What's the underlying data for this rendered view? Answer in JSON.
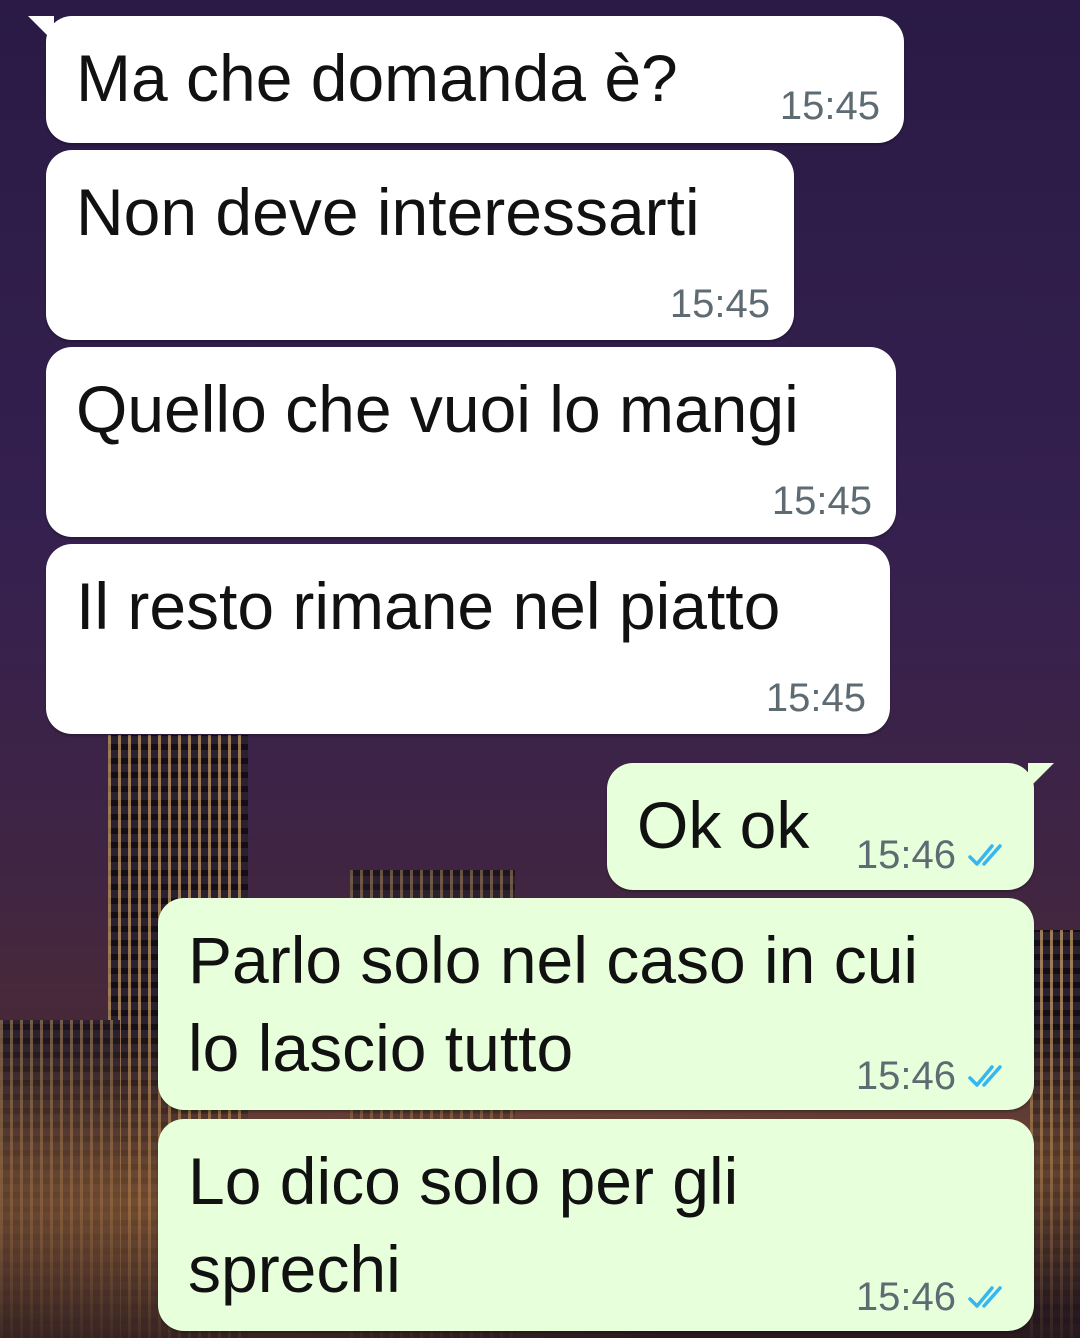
{
  "messages": [
    {
      "text": "Ma che domanda è?",
      "time": "15:45"
    },
    {
      "text": "Non deve interessarti",
      "time": "15:45"
    },
    {
      "text": "Quello che vuoi lo mangi",
      "time": "15:45"
    },
    {
      "text": "Il resto rimane nel piatto",
      "time": "15:45"
    },
    {
      "text": "Ok ok",
      "time": "15:46",
      "status_icon": "double-check-icon"
    },
    {
      "text": "Parlo solo nel caso in cui",
      "text2": "lo lascio tutto",
      "time": "15:46",
      "status_icon": "double-check-icon"
    },
    {
      "text": "Lo dico solo per gli",
      "text2": "sprechi",
      "time": "15:46",
      "status_icon": "double-check-icon"
    }
  ],
  "colors": {
    "incoming_bubble": "#ffffff",
    "outgoing_bubble": "#e7ffdb",
    "timestamp": "#5f6b73",
    "read_tick": "#34b7f1"
  }
}
